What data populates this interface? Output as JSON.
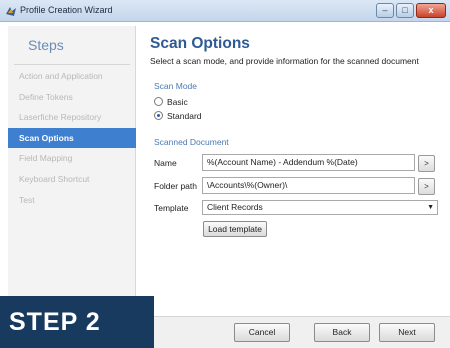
{
  "window": {
    "title": "Profile Creation Wizard",
    "minimize_glyph": "–",
    "maximize_glyph": "□",
    "close_glyph": "x"
  },
  "sidebar": {
    "heading": "Steps",
    "items": [
      {
        "label": "Action and Application",
        "state": "done"
      },
      {
        "label": "Define Tokens",
        "state": "done"
      },
      {
        "label": "Laserfiche Repository",
        "state": "done"
      },
      {
        "label": "Scan Options",
        "state": "active"
      },
      {
        "label": "Field Mapping",
        "state": "pending"
      },
      {
        "label": "Keyboard Shortcut",
        "state": "pending"
      },
      {
        "label": "Test",
        "state": "pending"
      }
    ]
  },
  "main": {
    "title": "Scan Options",
    "subtitle": "Select a scan mode, and provide information for the scanned document",
    "scan_mode": {
      "label": "Scan Mode",
      "options": [
        {
          "label": "Basic",
          "checked": false
        },
        {
          "label": "Standard",
          "checked": true
        }
      ]
    },
    "scanned_document": {
      "label": "Scanned Document",
      "name_label": "Name",
      "name_value": "%(Account Name) - Addendum %(Date)",
      "folder_label": "Folder path",
      "folder_value": "\\Accounts\\%(Owner)\\",
      "browse_glyph": ">",
      "template_label": "Template",
      "template_value": "Client Records",
      "load_template_label": "Load template"
    }
  },
  "footer": {
    "cancel_label": "Cancel",
    "back_label": "Back",
    "next_label": "Next"
  },
  "banner": {
    "text": "STEP 2"
  },
  "colors": {
    "accent": "#3f7fd0",
    "title_blue": "#2f5a96",
    "banner_bg": "#173a5e"
  }
}
